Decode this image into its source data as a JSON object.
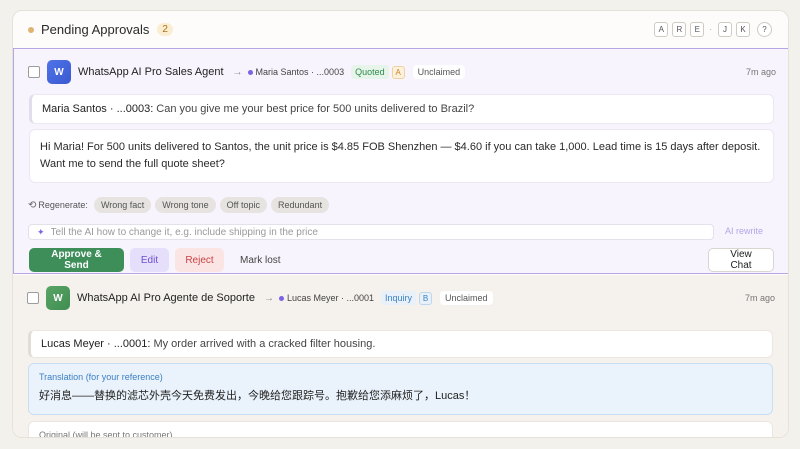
{
  "header": {
    "title": "Pending Approvals",
    "count": "2",
    "shortcuts": [
      "A",
      "R",
      "E",
      "J",
      "K"
    ],
    "help": "?"
  },
  "cards": [
    {
      "avatar": "W",
      "agent": "WhatsApp AI Pro Sales Agent",
      "contact": "Maria Santos · ...0003",
      "status": "Quoted",
      "grade": "A",
      "claim": "Unclaimed",
      "time": "7m ago",
      "message_sender": "Maria Santos · ...0003:",
      "message_text": "Can you give me your best price for 500 units delivered to Brazil?",
      "reply": "Hi Maria! For 500 units delivered to Santos, the unit price is $4.85 FOB Shenzhen — $4.60 if you can take 1,000. Lead time is 15 days after deposit. Want me to send the full quote sheet?",
      "regenerate_label": "Regenerate:",
      "regenerate_options": [
        "Wrong fact",
        "Wrong tone",
        "Off topic",
        "Redundant"
      ],
      "rewrite_placeholder": "Tell the AI how to change it, e.g. include shipping in the price",
      "ai_rewrite": "AI rewrite",
      "actions": {
        "approve": "Approve & Send",
        "edit": "Edit",
        "reject": "Reject",
        "lost": "Mark lost",
        "view_chat": "View Chat"
      }
    },
    {
      "avatar": "W",
      "agent": "WhatsApp AI Pro Agente de Soporte",
      "contact": "Lucas Meyer · ...0001",
      "status": "Inquiry",
      "grade": "B",
      "claim": "Unclaimed",
      "time": "7m ago",
      "message_sender": "Lucas Meyer · ...0001:",
      "message_text": "My order arrived with a cracked filter housing.",
      "translation_label": "Translation (for your reference)",
      "translation_text": "好消息——替换的滤芯外壳今天免费发出，今晚给您跟踪号。抱歉给您添麻烦了，Lucas！",
      "original_label": "Original (will be sent to customer)"
    }
  ]
}
